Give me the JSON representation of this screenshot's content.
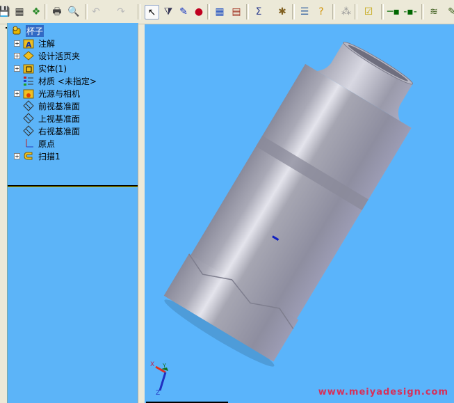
{
  "toolbar": {
    "buttons": [
      {
        "name": "save",
        "icon": "save-icon",
        "glyph": "💾"
      },
      {
        "name": "options",
        "icon": "options-icon",
        "glyph": "▦"
      },
      {
        "name": "file-properties",
        "icon": "file-properties-icon",
        "glyph": "❖"
      },
      {
        "name": "print",
        "icon": "print-icon",
        "glyph": "🖶"
      },
      {
        "name": "print-preview",
        "icon": "print-preview-icon",
        "glyph": "🔍"
      },
      {
        "name": "undo",
        "icon": "undo-icon",
        "glyph": "↶"
      },
      {
        "name": "redo",
        "icon": "redo-icon",
        "glyph": "↷"
      },
      {
        "name": "select",
        "icon": "select-cursor-icon",
        "glyph": "↖"
      },
      {
        "name": "selection-filter",
        "icon": "filter-icon",
        "glyph": "⧩"
      },
      {
        "name": "sketch",
        "icon": "sketch-icon",
        "glyph": "✎"
      },
      {
        "name": "rebuild",
        "icon": "traffic-light-icon",
        "glyph": "●"
      },
      {
        "name": "edit-color",
        "icon": "color-palette-icon",
        "glyph": "▦"
      },
      {
        "name": "edit-texture",
        "icon": "brick-texture-icon",
        "glyph": "▤"
      },
      {
        "name": "equations",
        "icon": "sigma-icon",
        "glyph": "Σ"
      },
      {
        "name": "measure",
        "icon": "measure-icon",
        "glyph": "✱"
      },
      {
        "name": "properties",
        "icon": "list-icon",
        "glyph": "☰"
      },
      {
        "name": "help",
        "icon": "help-icon",
        "glyph": "?"
      },
      {
        "name": "assembly",
        "icon": "assembly-icon",
        "glyph": "⁂"
      },
      {
        "name": "check",
        "icon": "check-list-icon",
        "glyph": "☑"
      },
      {
        "name": "mate1",
        "icon": "mate-icon",
        "glyph": "─▪"
      },
      {
        "name": "mate2",
        "icon": "mate-icon",
        "glyph": "-▪-"
      },
      {
        "name": "layers",
        "icon": "layers-icon",
        "glyph": "≋"
      },
      {
        "name": "more",
        "icon": "more-icon",
        "glyph": "✎"
      }
    ]
  },
  "panel": {
    "tabs": [
      {
        "name": "feature-manager",
        "icon": "feature-tree-icon",
        "glyph": "↖"
      },
      {
        "name": "property-manager",
        "icon": "property-manager-icon",
        "glyph": "📄"
      },
      {
        "name": "configuration-manager",
        "icon": "configuration-icon",
        "glyph": "⧉"
      },
      {
        "name": "display-manager",
        "icon": "display-icon",
        "glyph": "▣"
      }
    ],
    "expand_glyph": "»"
  },
  "tree": {
    "root": {
      "label": "杯子",
      "icon": "part-icon"
    },
    "items": [
      {
        "label": "注解",
        "icon": "annotations-folder-icon",
        "expandable": true
      },
      {
        "label": "设计活页夹",
        "icon": "design-binder-icon",
        "expandable": true
      },
      {
        "label": "实体(1)",
        "icon": "solid-bodies-folder-icon",
        "expandable": true
      },
      {
        "label": "材质 <未指定>",
        "icon": "material-icon",
        "expandable": false
      },
      {
        "label": "光源与相机",
        "icon": "lights-cameras-folder-icon",
        "expandable": true
      },
      {
        "label": "前视基准面",
        "icon": "plane-icon",
        "expandable": false
      },
      {
        "label": "上视基准面",
        "icon": "plane-icon",
        "expandable": false
      },
      {
        "label": "右视基准面",
        "icon": "plane-icon",
        "expandable": false
      },
      {
        "label": "原点",
        "icon": "origin-icon",
        "expandable": false
      },
      {
        "label": "扫描1",
        "icon": "sweep-icon",
        "expandable": true
      }
    ]
  },
  "viewport": {
    "background": "#5ab4fb",
    "triad": {
      "x": "X",
      "y": "Y",
      "z": "Z"
    },
    "watermark": "www.meiyadesign.com"
  }
}
